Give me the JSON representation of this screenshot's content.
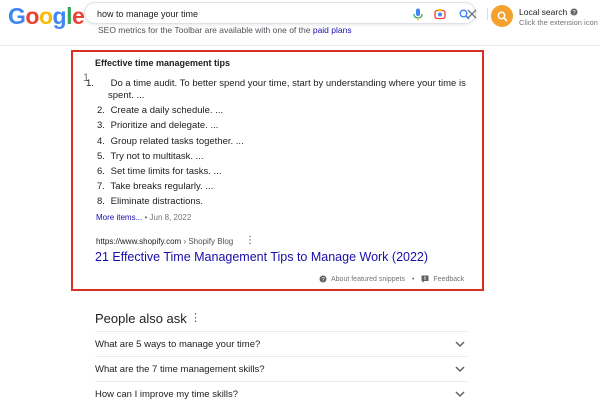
{
  "header": {
    "logo": {
      "letters": [
        "G",
        "o",
        "o",
        "g",
        "l",
        "e"
      ],
      "colors": [
        "#4285F4",
        "#EA4335",
        "#FBBC05",
        "#4285F4",
        "#34A853",
        "#EA4335"
      ]
    },
    "search": {
      "value": "how to manage your time"
    },
    "icons": [
      "close-icon",
      "microphone-icon",
      "camera-lens-icon",
      "search-icon"
    ],
    "toolbar_text": "SEO metrics for the Toolbar are available with one of the",
    "toolbar_link": "paid plans",
    "local_search": {
      "title": "Local search",
      "help_icon": "help-circle-icon",
      "subtitle": "Click the extension icon to"
    }
  },
  "snippet": {
    "border_color": "#d93025",
    "marker": "1",
    "title": "Effective time management tips",
    "items": [
      {
        "num": "1.",
        "text": "Do a time audit. To better spend your time, start by understanding where your time is spent. ..."
      },
      {
        "num": "2.",
        "text": "Create a daily schedule. ..."
      },
      {
        "num": "3.",
        "text": "Prioritize and delegate. ..."
      },
      {
        "num": "4.",
        "text": "Group related tasks together. ..."
      },
      {
        "num": "5.",
        "text": "Try not to multitask. ..."
      },
      {
        "num": "6.",
        "text": "Set time limits for tasks. ..."
      },
      {
        "num": "7.",
        "text": "Take breaks regularly. ..."
      },
      {
        "num": "8.",
        "text": "Eliminate distractions."
      }
    ],
    "more_items": "More items...",
    "separator": "•",
    "date": "Jun 8, 2022",
    "source_url": "https://www.shopify.com",
    "source_crumb": "› Shopify Blog",
    "result_title": "21 Effective Time Management Tips to Manage Work (2022)",
    "about_label": "About featured snippets",
    "footer_separator": "•",
    "feedback_label": "Feedback"
  },
  "paa": {
    "title": "People also ask",
    "questions": [
      "What are 5 ways to manage your time?",
      "What are the 7 time management skills?",
      "How can I improve my time skills?"
    ]
  }
}
